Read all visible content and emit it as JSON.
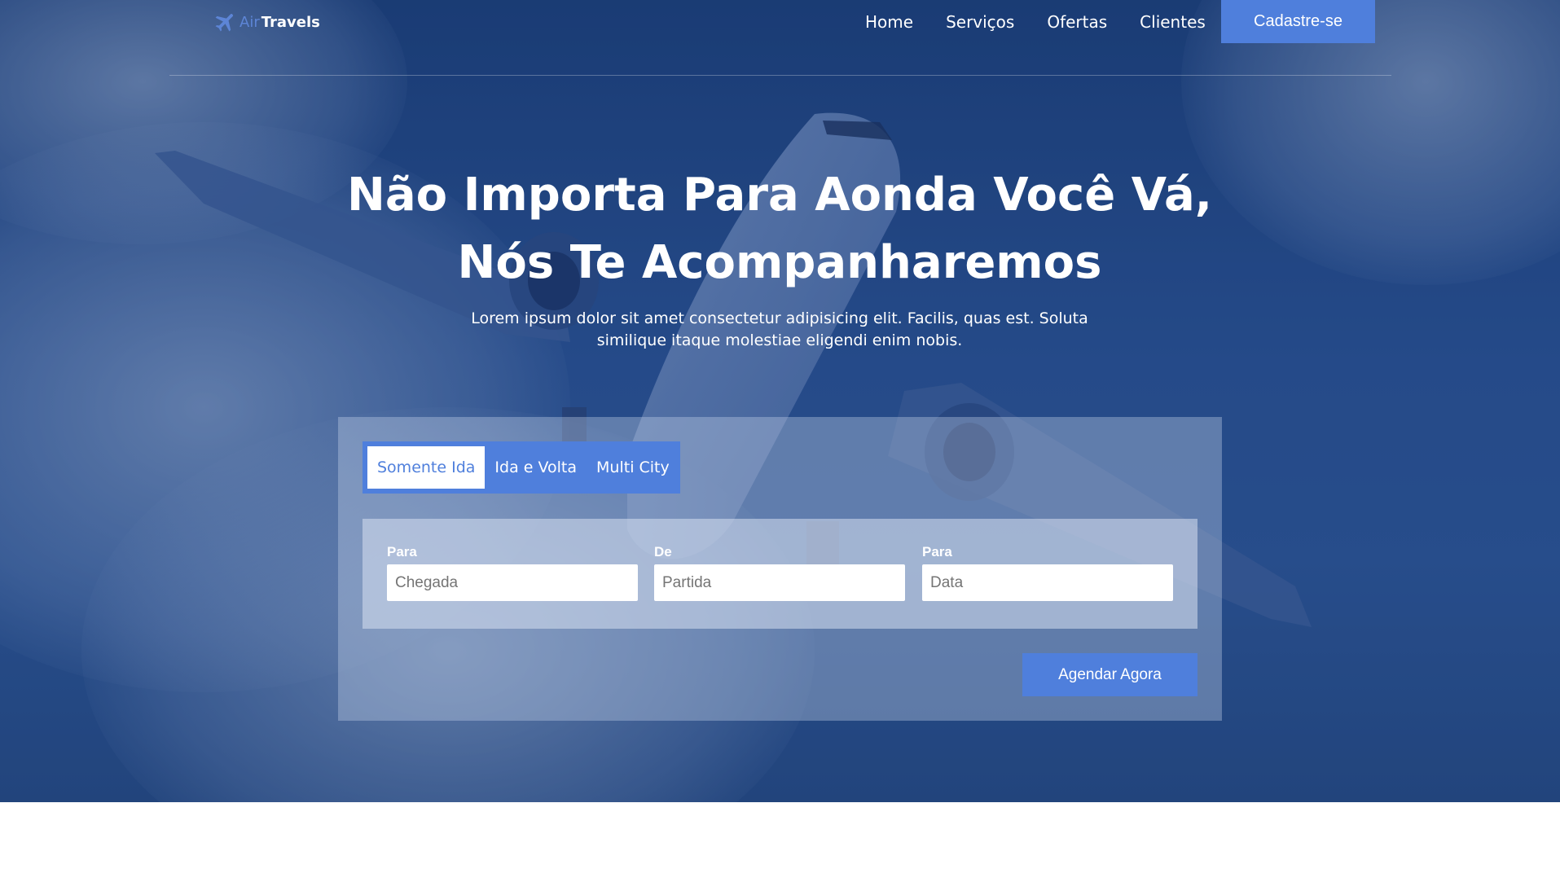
{
  "brand": {
    "part1": "Air",
    "part2": "Travels",
    "icon": "airplane-icon",
    "accent": "#5d85d6"
  },
  "nav": {
    "links": [
      "Home",
      "Serviços",
      "Ofertas",
      "Clientes"
    ],
    "signup_label": "Cadastre-se"
  },
  "hero": {
    "title_line1": "Não Importa Para Aonda Você Vá,",
    "title_line2": "Nós Te Acompanharemos",
    "subtitle_line1": "Lorem ipsum dolor sit amet consectetur adipisicing elit. Facilis, quas est. Soluta",
    "subtitle_line2": "similique itaque molestiae eligendi enim nobis."
  },
  "booking": {
    "tabs": [
      {
        "label": "Somente Ida",
        "active": true
      },
      {
        "label": "Ida e Volta",
        "active": false
      },
      {
        "label": "Multi City",
        "active": false
      }
    ],
    "fields": [
      {
        "label": "Para",
        "placeholder": "Chegada"
      },
      {
        "label": "De",
        "placeholder": "Partida"
      },
      {
        "label": "Para",
        "placeholder": "Data"
      }
    ],
    "submit_label": "Agendar Agora"
  },
  "colors": {
    "primary": "#4f7fdc",
    "hero_bg": "#1b3d74",
    "text_light": "#ffffff"
  }
}
